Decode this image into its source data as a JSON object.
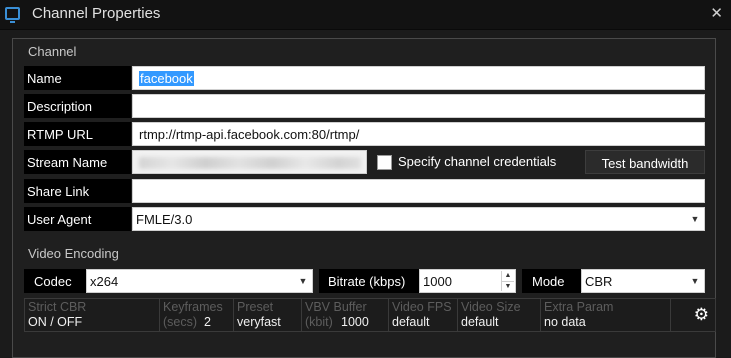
{
  "window": {
    "title": "Channel Properties",
    "close_glyph": "✕",
    "icon": "app-window-icon"
  },
  "channel": {
    "section_title": "Channel",
    "name_label": "Name",
    "name_value": "facebook",
    "description_label": "Description",
    "description_value": "",
    "rtmp_label": "RTMP URL",
    "rtmp_value": "rtmp://rtmp-api.facebook.com:80/rtmp/",
    "stream_label": "Stream Name",
    "credentials_label": "Specify channel credentials",
    "credentials_checked": false,
    "test_bandwidth_label": "Test bandwidth",
    "share_label": "Share Link",
    "share_value": "",
    "agent_label": "User Agent",
    "agent_value": "FMLE/3.0"
  },
  "video": {
    "section_title": "Video Encoding",
    "codec_label": "Codec",
    "codec_value": "x264",
    "bitrate_label": "Bitrate (kbps)",
    "bitrate_value": "1000",
    "mode_label": "Mode",
    "mode_value": "CBR",
    "params": {
      "strict_cbr_label": "Strict CBR",
      "strict_cbr_on": "ON",
      "strict_cbr_off": " / OFF",
      "keyframes_label": "Keyframes",
      "keyframes_sub": "(secs)",
      "keyframes_value": "2",
      "preset_label": "Preset",
      "preset_value": "veryfast",
      "vbv_label": "VBV Buffer",
      "vbv_sub": "(kbit)",
      "vbv_value": "1000",
      "fps_label": "Video FPS",
      "fps_value": "default",
      "size_label": "Video Size",
      "size_value": "default",
      "extra_label": "Extra Param",
      "extra_value": "no data"
    }
  },
  "icons": {
    "dropdown": "▼",
    "spin_up": "▲",
    "spin_down": "▼",
    "gear": "⚙"
  }
}
